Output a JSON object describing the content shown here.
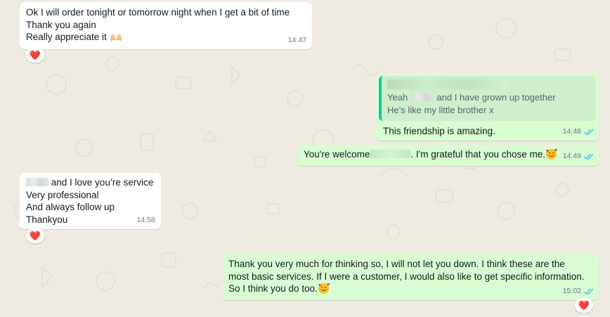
{
  "messages": [
    {
      "id": "m1",
      "direction": "incoming",
      "lines": [
        "Ok I will order tonight or tomorrow night when I get a bit of time",
        "Thank you again",
        "Really appreciate it"
      ],
      "trailing_emoji": "open-hands-emoji",
      "time": "14:47",
      "reaction": "❤️"
    },
    {
      "id": "m2",
      "direction": "outgoing",
      "quote": {
        "author_redacted": true,
        "line1_prefix": "Yeah",
        "line1_suffix": "and I have grown up together",
        "line2": "He’s like my little brother x"
      },
      "text": "This friendship is amazing.",
      "time": "14:48",
      "status": "read"
    },
    {
      "id": "m3",
      "direction": "outgoing",
      "text_prefix": "You're welcome",
      "text_suffix": ". I'm grateful that you chose me.",
      "trailing_emoji": "smiling-face-with-hearts-emoji",
      "time": "14:49",
      "status": "read"
    },
    {
      "id": "m4",
      "direction": "incoming",
      "lines_first_suffix": "and I love you’re service",
      "lines": [
        "Very professional",
        "And always follow up",
        "Thankyou"
      ],
      "time": "14:58",
      "reaction": "❤️"
    },
    {
      "id": "m5",
      "direction": "outgoing",
      "lines": [
        "Thank you very much for thinking so, I will not let you down. I think these are the",
        "most basic services. If I were a customer, I would also like to get specific information.",
        "So I think you do too."
      ],
      "trailing_emoji": "smiling-face-with-hearts-emoji",
      "time": "15:02",
      "status": "read",
      "reaction": "❤️"
    }
  ],
  "colors": {
    "wallpaper": "#efeae2",
    "incoming_bubble": "#ffffff",
    "outgoing_bubble": "#d9fdd3",
    "read_ticks": "#53bdeb",
    "quote_bar": "#06cf9c",
    "heart": "#e8283b"
  }
}
